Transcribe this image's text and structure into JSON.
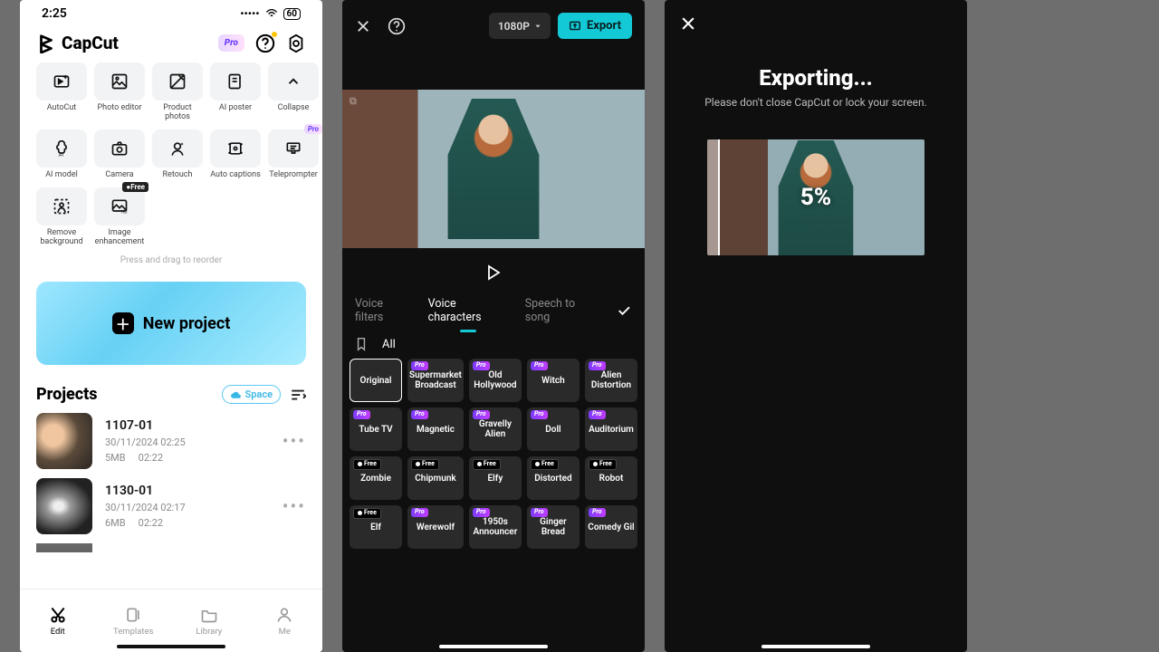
{
  "home": {
    "status": {
      "time": "2:25",
      "battery": "60"
    },
    "app_name": "CapCut",
    "pro_label": "Pro",
    "free_label": "Free",
    "tools": [
      {
        "label": "AutoCut"
      },
      {
        "label": "Photo editor"
      },
      {
        "label": "Product photos"
      },
      {
        "label": "AI poster"
      },
      {
        "label": "Collapse"
      },
      {
        "label": "AI model"
      },
      {
        "label": "Camera"
      },
      {
        "label": "Retouch"
      },
      {
        "label": "Auto captions"
      },
      {
        "label": "Teleprompter"
      },
      {
        "label": "Remove background"
      },
      {
        "label": "Image enhancement"
      }
    ],
    "reorder_hint": "Press and drag to reorder",
    "new_project": "New project",
    "projects_title": "Projects",
    "space_label": "Space",
    "projects": [
      {
        "name": "1107-01",
        "date": "30/11/2024 02:25",
        "size": "5MB",
        "duration": "02:22"
      },
      {
        "name": "1130-01",
        "date": "30/11/2024 02:17",
        "size": "6MB",
        "duration": "02:22"
      }
    ],
    "tabs": [
      "Edit",
      "Templates",
      "Library",
      "Me"
    ]
  },
  "editor": {
    "resolution": "1080P",
    "export_label": "Export",
    "voice_tabs": [
      "Voice filters",
      "Voice characters",
      "Speech to song"
    ],
    "category_all": "All",
    "voices": [
      {
        "label": "Original",
        "badge": null,
        "selected": true
      },
      {
        "label": "Supermarket Broadcast",
        "badge": "pro"
      },
      {
        "label": "Old Hollywood",
        "badge": "pro"
      },
      {
        "label": "Witch",
        "badge": "pro"
      },
      {
        "label": "Alien Distortion",
        "badge": "pro"
      },
      {
        "label": "Tube TV",
        "badge": "pro"
      },
      {
        "label": "Magnetic",
        "badge": "pro"
      },
      {
        "label": "Gravelly Alien",
        "badge": "pro"
      },
      {
        "label": "Doll",
        "badge": "pro"
      },
      {
        "label": "Auditorium",
        "badge": "pro"
      },
      {
        "label": "Zombie",
        "badge": "free"
      },
      {
        "label": "Chipmunk",
        "badge": "free"
      },
      {
        "label": "Elfy",
        "badge": "free"
      },
      {
        "label": "Distorted",
        "badge": "free"
      },
      {
        "label": "Robot",
        "badge": "free"
      },
      {
        "label": "Elf",
        "badge": "free"
      },
      {
        "label": "Werewolf",
        "badge": "pro"
      },
      {
        "label": "1950s Announcer",
        "badge": "pro"
      },
      {
        "label": "Ginger Bread",
        "badge": "pro"
      },
      {
        "label": "Comedy Gil",
        "badge": "pro"
      }
    ]
  },
  "exporting": {
    "title": "Exporting...",
    "subtitle": "Please don't close CapCut or lock your screen.",
    "percent": "5%"
  }
}
